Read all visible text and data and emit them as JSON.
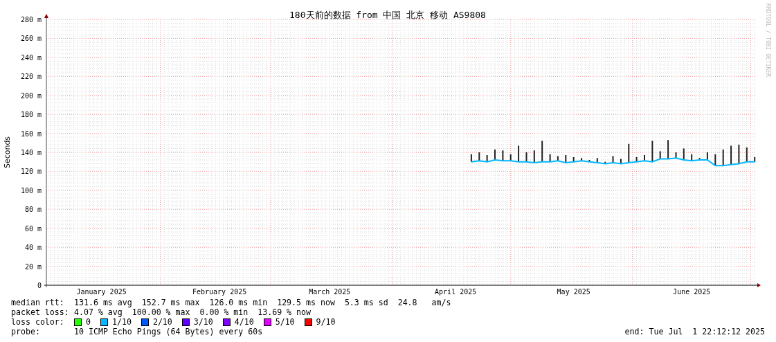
{
  "chart": {
    "chart_data": {
      "type": "line",
      "grid": true,
      "title": "180天前的数据 from 中国 北京 移动 AS9808",
      "ylabel": "Seconds",
      "ylim": [
        0,
        280
      ],
      "yticks": [
        {
          "value": 0,
          "label": "0"
        },
        {
          "value": 20,
          "label": "20 m"
        },
        {
          "value": 40,
          "label": "40 m"
        },
        {
          "value": 60,
          "label": "60 m"
        },
        {
          "value": 80,
          "label": "80 m"
        },
        {
          "value": 100,
          "label": "100 m"
        },
        {
          "value": 120,
          "label": "120 m"
        },
        {
          "value": 140,
          "label": "140 m"
        },
        {
          "value": 160,
          "label": "160 m"
        },
        {
          "value": 180,
          "label": "180 m"
        },
        {
          "value": 200,
          "label": "200 m"
        },
        {
          "value": 220,
          "label": "220 m"
        },
        {
          "value": 240,
          "label": "240 m"
        },
        {
          "value": 260,
          "label": "260 m"
        },
        {
          "value": 280,
          "label": "280 m"
        }
      ],
      "categories": [
        null,
        null,
        null,
        null,
        null,
        null,
        null,
        "January 2025",
        null,
        null,
        null,
        null,
        null,
        null,
        null,
        null,
        null,
        null,
        null,
        null,
        null,
        null,
        "February 2025",
        null,
        null,
        null,
        null,
        null,
        null,
        null,
        null,
        null,
        null,
        null,
        null,
        null,
        "March 2025",
        null,
        null,
        null,
        null,
        null,
        null,
        null,
        null,
        null,
        null,
        null,
        null,
        null,
        null,
        null,
        "April 2025",
        null,
        null,
        null,
        null,
        null,
        null,
        null,
        null,
        null,
        null,
        null,
        null,
        null,
        null,
        "May 2025",
        null,
        null,
        null,
        null,
        null,
        null,
        null,
        null,
        null,
        null,
        null,
        null,
        null,
        null,
        "June 2025",
        null,
        null,
        null,
        null,
        null,
        null,
        null,
        null
      ],
      "series": [
        {
          "color": "#00b8ff",
          "values": [
            null,
            null,
            null,
            null,
            null,
            null,
            null,
            null,
            null,
            null,
            null,
            null,
            null,
            null,
            null,
            null,
            null,
            null,
            null,
            null,
            null,
            null,
            null,
            null,
            null,
            null,
            null,
            null,
            null,
            null,
            null,
            null,
            null,
            null,
            null,
            null,
            null,
            null,
            null,
            null,
            null,
            null,
            null,
            null,
            null,
            null,
            null,
            null,
            null,
            null,
            null,
            null,
            null,
            null,
            130,
            131,
            130,
            132,
            131,
            131,
            130,
            130,
            129,
            130,
            130,
            131,
            129,
            130,
            131,
            130,
            129,
            128,
            129,
            128,
            129,
            130,
            131,
            130,
            133,
            133,
            134,
            132,
            131,
            132,
            132,
            126,
            126,
            127,
            128,
            130,
            130
          ]
        }
      ]
    },
    "credit": "RRDTOOL / TOBI OETIKER"
  },
  "stats": [
    {
      "label": "median rtt:",
      "value": "131.6 ms avg  152.7 ms max  126.0 ms min  129.5 ms now  5.3 ms sd  24.8   am/s"
    },
    {
      "label": "packet loss:",
      "value": "4.07 % avg  100.00 % max  0.00 % min  13.69 % now"
    }
  ],
  "loss_colors": {
    "label": "loss color:",
    "items": [
      {
        "label": "0",
        "color": "#26ff00"
      },
      {
        "label": "1/10",
        "color": "#00b8ff"
      },
      {
        "label": "2/10",
        "color": "#0059ff"
      },
      {
        "label": "3/10",
        "color": "#5e00ff"
      },
      {
        "label": "4/10",
        "color": "#7e00ff"
      },
      {
        "label": "5/10",
        "color": "#dd00ff"
      },
      {
        "label": "9/10",
        "color": "#ff0000"
      }
    ]
  },
  "probe": {
    "label": "probe:",
    "value": "10 ICMP Echo Pings (64 Bytes) every 60s",
    "end": "end: Tue Jul  1 22:12:12 2025"
  }
}
